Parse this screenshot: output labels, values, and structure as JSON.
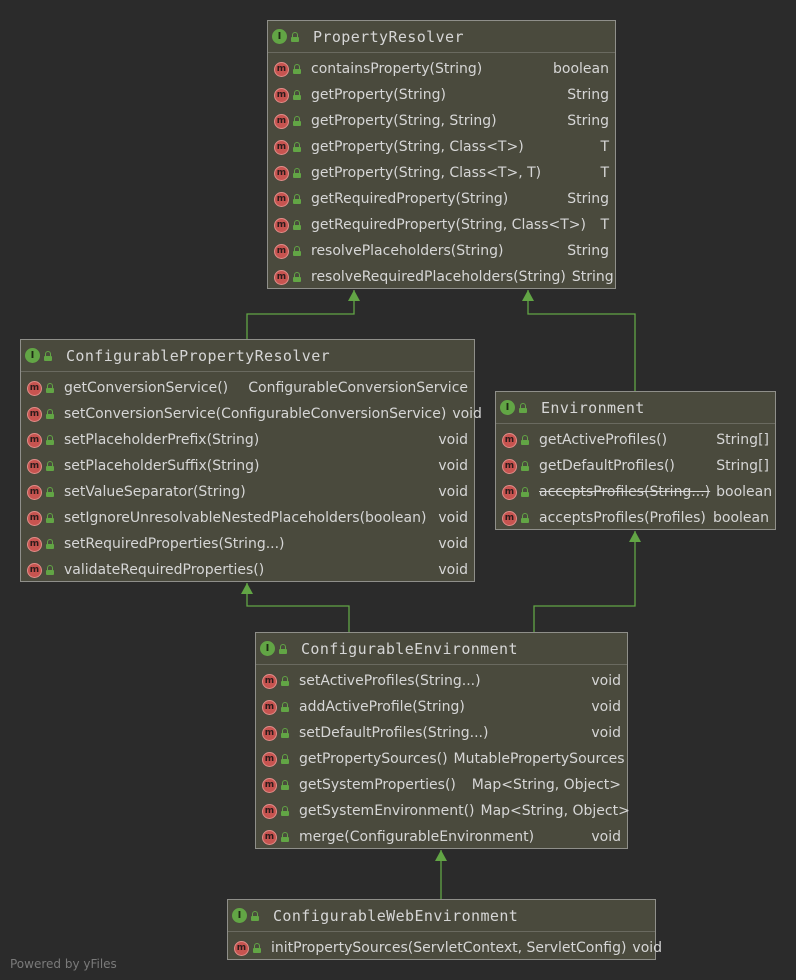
{
  "nodes": {
    "property_resolver": {
      "title": "PropertyResolver",
      "members": [
        {
          "name": "containsProperty(String)",
          "type": "boolean"
        },
        {
          "name": "getProperty(String)",
          "type": "String"
        },
        {
          "name": "getProperty(String, String)",
          "type": "String"
        },
        {
          "name": "getProperty(String, Class<T>)",
          "type": "T"
        },
        {
          "name": "getProperty(String, Class<T>, T)",
          "type": "T"
        },
        {
          "name": "getRequiredProperty(String)",
          "type": "String"
        },
        {
          "name": "getRequiredProperty(String, Class<T>)",
          "type": "T"
        },
        {
          "name": "resolvePlaceholders(String)",
          "type": "String"
        },
        {
          "name": "resolveRequiredPlaceholders(String)",
          "type": "String"
        }
      ]
    },
    "configurable_property_resolver": {
      "title": "ConfigurablePropertyResolver",
      "members": [
        {
          "name": "getConversionService()",
          "type": "ConfigurableConversionService"
        },
        {
          "name": "setConversionService(ConfigurableConversionService)",
          "type": "void"
        },
        {
          "name": "setPlaceholderPrefix(String)",
          "type": "void"
        },
        {
          "name": "setPlaceholderSuffix(String)",
          "type": "void"
        },
        {
          "name": "setValueSeparator(String)",
          "type": "void"
        },
        {
          "name": "setIgnoreUnresolvableNestedPlaceholders(boolean)",
          "type": "void"
        },
        {
          "name": "setRequiredProperties(String...)",
          "type": "void"
        },
        {
          "name": "validateRequiredProperties()",
          "type": "void"
        }
      ]
    },
    "environment": {
      "title": "Environment",
      "members": [
        {
          "name": "getActiveProfiles()",
          "type": "String[]"
        },
        {
          "name": "getDefaultProfiles()",
          "type": "String[]"
        },
        {
          "name": "acceptsProfiles(String...)",
          "type": "boolean",
          "deprecated": true
        },
        {
          "name": "acceptsProfiles(Profiles)",
          "type": "boolean"
        }
      ]
    },
    "configurable_environment": {
      "title": "ConfigurableEnvironment",
      "members": [
        {
          "name": "setActiveProfiles(String...)",
          "type": "void"
        },
        {
          "name": "addActiveProfile(String)",
          "type": "void"
        },
        {
          "name": "setDefaultProfiles(String...)",
          "type": "void"
        },
        {
          "name": "getPropertySources()",
          "type": "MutablePropertySources"
        },
        {
          "name": "getSystemProperties()",
          "type": "Map<String, Object>"
        },
        {
          "name": "getSystemEnvironment()",
          "type": "Map<String, Object>"
        },
        {
          "name": "merge(ConfigurableEnvironment)",
          "type": "void"
        }
      ]
    },
    "configurable_web_environment": {
      "title": "ConfigurableWebEnvironment",
      "members": [
        {
          "name": "initPropertySources(ServletContext, ServletConfig)",
          "type": "void"
        }
      ]
    }
  },
  "icons": {
    "interface_letter": "I",
    "method_letter": "m"
  },
  "edges": [
    {
      "from": "configurable_property_resolver",
      "to": "property_resolver",
      "kind": "extends"
    },
    {
      "from": "environment",
      "to": "property_resolver",
      "kind": "extends"
    },
    {
      "from": "configurable_environment",
      "to": "configurable_property_resolver",
      "kind": "extends"
    },
    {
      "from": "configurable_environment",
      "to": "environment",
      "kind": "extends"
    },
    {
      "from": "configurable_web_environment",
      "to": "configurable_environment",
      "kind": "extends"
    }
  ],
  "colors": {
    "background": "#2b2b2b",
    "node_fill": "#4a4a3d",
    "node_border": "#8f8f8a",
    "edge": "#62a545",
    "interface_icon": "#62a545",
    "method_icon": "#c75450",
    "text": "#d6d6d6"
  },
  "footer": {
    "watermark": "Powered by yFiles"
  }
}
